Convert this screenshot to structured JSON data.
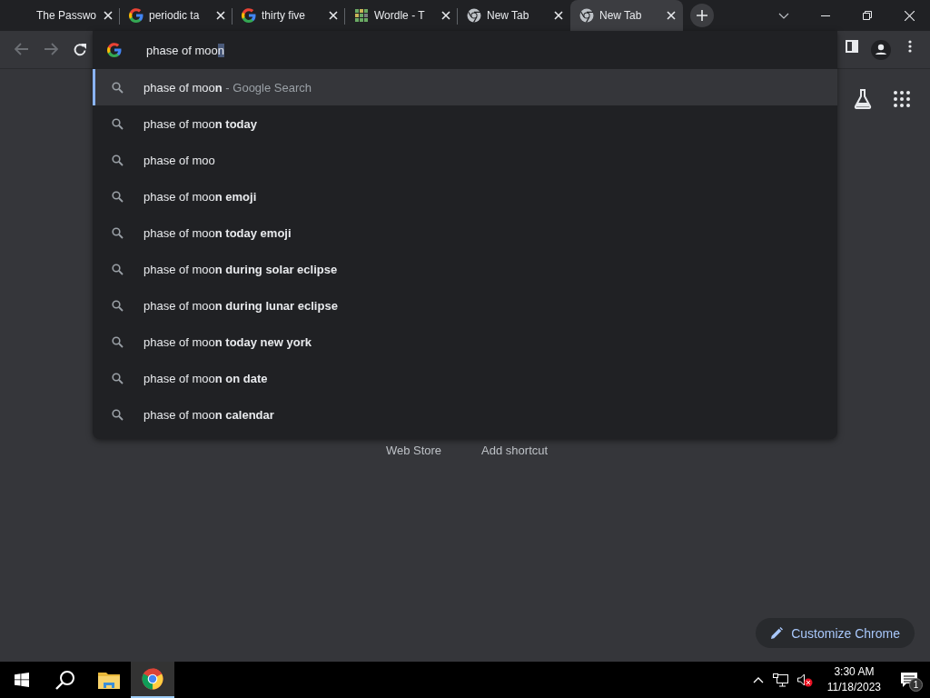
{
  "tabs": [
    {
      "title": "The Passwo",
      "kind": "plain",
      "selected": false
    },
    {
      "title": "periodic ta",
      "kind": "google",
      "selected": false
    },
    {
      "title": "thirty five",
      "kind": "google",
      "selected": false
    },
    {
      "title": "Wordle - T",
      "kind": "wordle",
      "selected": false
    },
    {
      "title": "New Tab",
      "kind": "chrome",
      "selected": false
    },
    {
      "title": "New Tab",
      "kind": "chrome",
      "selected": true
    }
  ],
  "omnibox": {
    "typed": "phase of moo",
    "autocomplete": "n"
  },
  "suggestions": [
    {
      "text": "phase of moo**n**",
      "suffix": "- Google Search",
      "selected": true
    },
    {
      "text": "phase of moo**n today**",
      "selected": false
    },
    {
      "text": "phase of moo",
      "selected": false
    },
    {
      "text": "phase of moo**n emoji**",
      "selected": false
    },
    {
      "text": "phase of moo**n today emoji**",
      "selected": false
    },
    {
      "text": "phase of moo**n during solar eclipse**",
      "selected": false
    },
    {
      "text": "phase of moo**n during lunar eclipse**",
      "selected": false
    },
    {
      "text": "phase of moo**n today new york**",
      "selected": false
    },
    {
      "text": "phase of moo**n on date**",
      "selected": false
    },
    {
      "text": "phase of moo**n calendar**",
      "selected": false
    }
  ],
  "page": {
    "links": [
      "Web Store",
      "Add shortcut"
    ],
    "customize_button": "Customize Chrome"
  },
  "taskbar": {
    "apps": [
      {
        "kind": "files",
        "selected": false
      },
      {
        "kind": "chrome",
        "selected": true
      }
    ],
    "time": "3:30 AM",
    "date": "11/18/2023",
    "notifications": "1"
  }
}
